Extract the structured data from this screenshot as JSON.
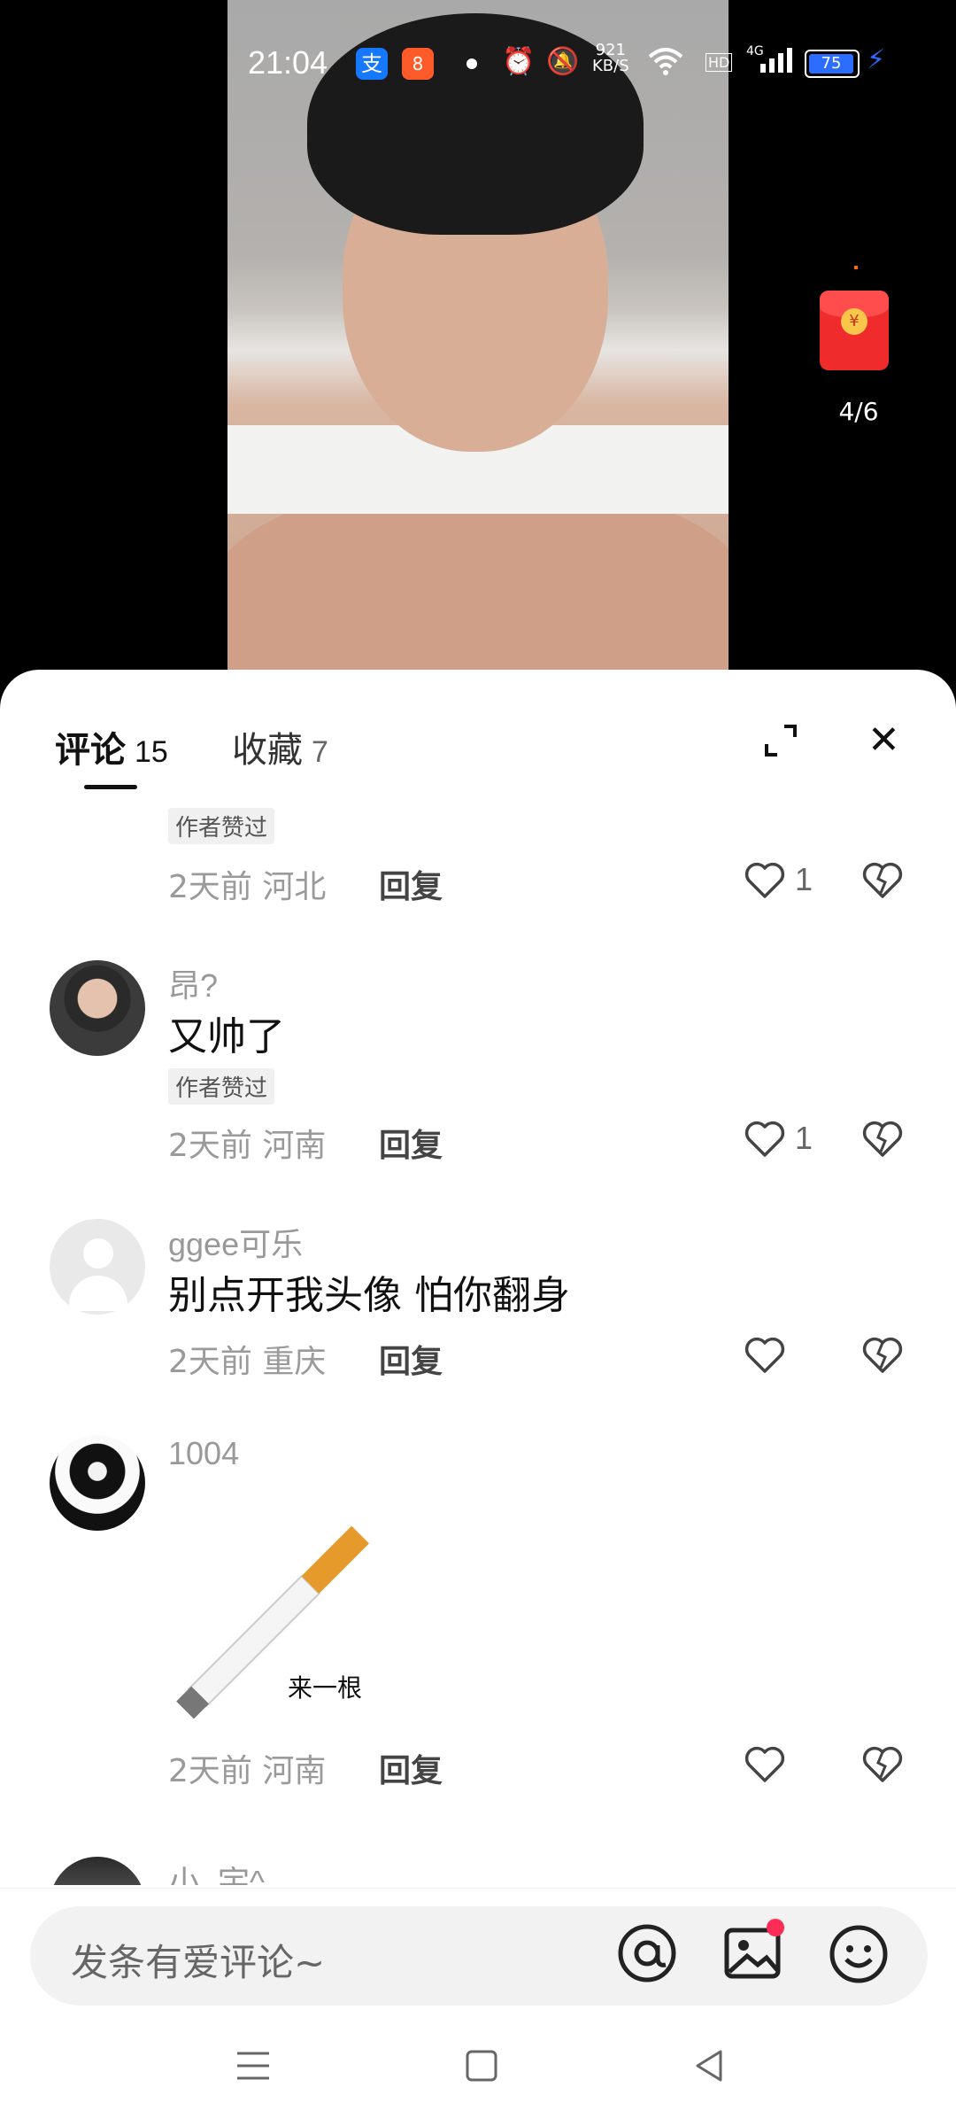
{
  "status_bar": {
    "time": "21:04",
    "network_speed_value": "921",
    "network_speed_unit": "KB/S",
    "hd": "HD",
    "signal": "4G",
    "battery": "75",
    "app1_glyph": "支",
    "app2_glyph": "8"
  },
  "video": {
    "progress": "4/6",
    "red_packet_glyph": "¥"
  },
  "tabs": {
    "comments_label": "评论",
    "comments_count": "15",
    "favorites_label": "收藏",
    "favorites_count": "7"
  },
  "comments": [
    {
      "author_liked_badge": "作者赞过",
      "time": "2天前",
      "location": "河北",
      "reply_label": "回复",
      "like_count": "1"
    },
    {
      "username": "昂?",
      "text": "又帅了",
      "author_liked_badge": "作者赞过",
      "time": "2天前",
      "location": "河南",
      "reply_label": "回复",
      "like_count": "1"
    },
    {
      "username": "ggee可乐",
      "text": "别点开我头像 怕你翻身",
      "time": "2天前",
      "location": "重庆",
      "reply_label": "回复",
      "like_count": ""
    },
    {
      "username": "1004",
      "sticker_label": "来一根",
      "time": "2天前",
      "location": "河南",
      "reply_label": "回复",
      "like_count": ""
    },
    {
      "username": "小_宇^"
    }
  ],
  "input": {
    "placeholder": "发条有爱评论~"
  },
  "colors": {
    "accent_red": "#ff2d55",
    "battery_blue": "#2c6cff"
  }
}
